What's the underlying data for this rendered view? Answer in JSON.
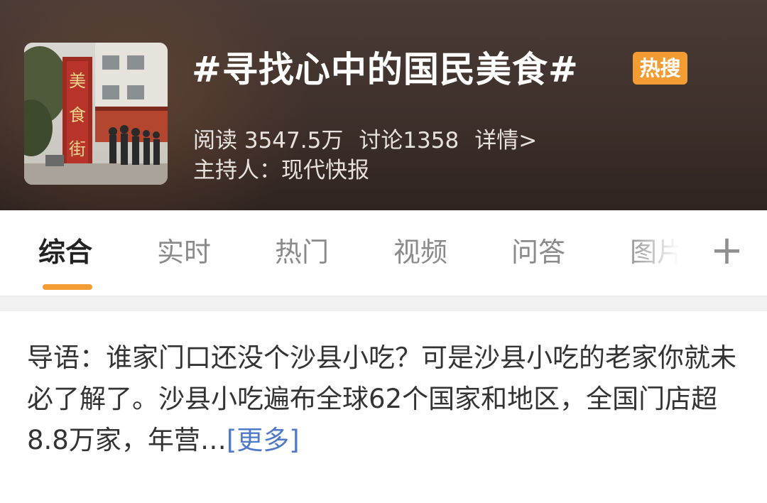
{
  "topic": {
    "title": "#寻找心中的国民美食#",
    "badge": "热搜",
    "reads": "阅读 3547.5万",
    "discussions": "讨论1358",
    "details_link": "详情>",
    "host": "主持人：现代快报",
    "thumbnail_sign": "美食街"
  },
  "tabs": [
    {
      "label": "综合",
      "active": true
    },
    {
      "label": "实时",
      "active": false
    },
    {
      "label": "热门",
      "active": false
    },
    {
      "label": "视频",
      "active": false
    },
    {
      "label": "问答",
      "active": false
    },
    {
      "label": "图片",
      "active": false
    }
  ],
  "tab_add_label": "+",
  "intro": {
    "text": "导语：谁家门口还没个沙县小吃？可是沙县小吃的老家你就未必了解了。沙县小吃遍布全球62个国家和地区，全国门店超8.8万家，年营…",
    "more_label": "[更多]"
  },
  "colors": {
    "accent": "#f39c34",
    "header_bg": "#3e302b",
    "link": "#4f7ac7"
  }
}
